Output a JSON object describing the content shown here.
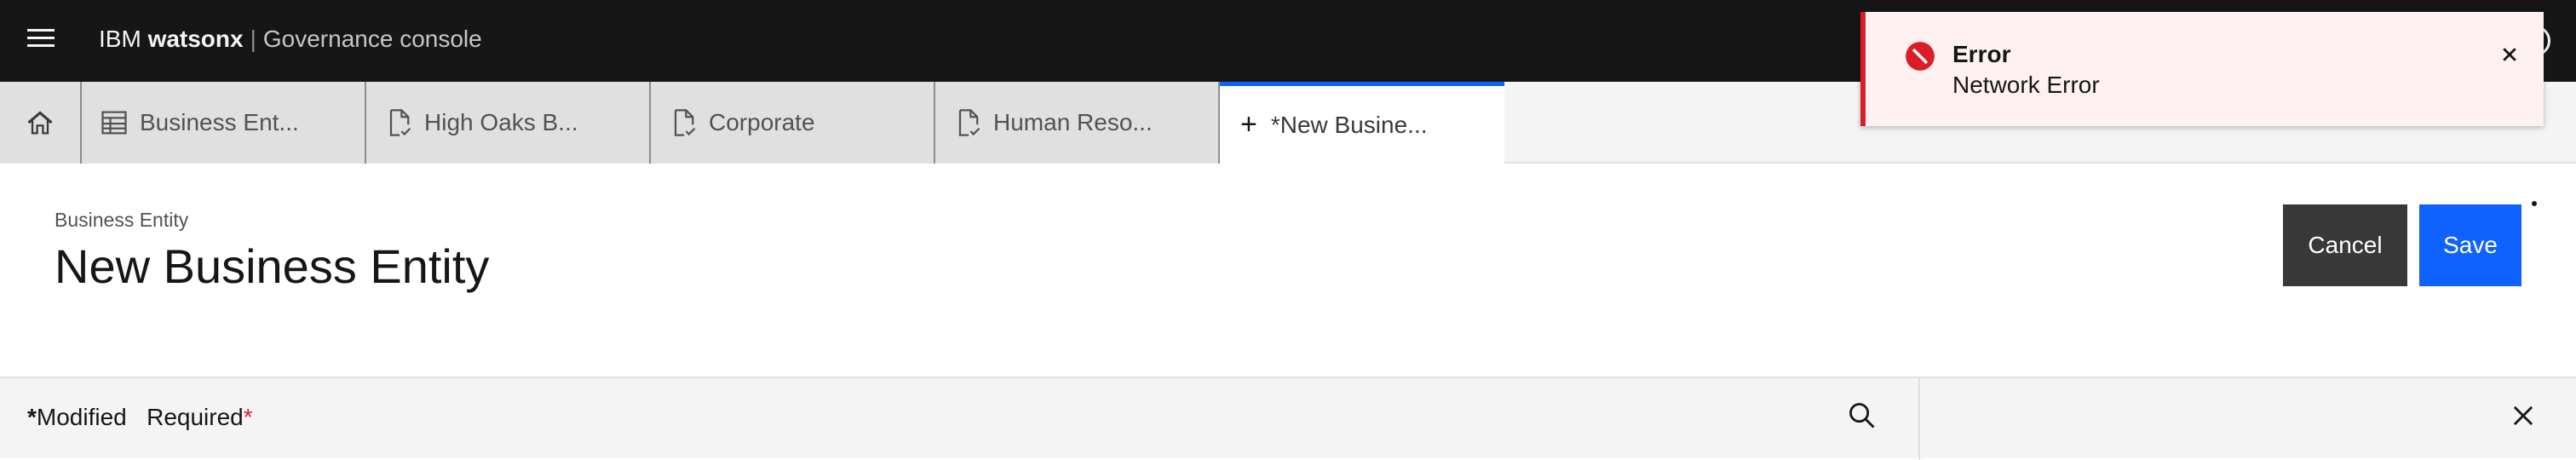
{
  "header": {
    "brand_prefix": "IBM ",
    "brand_bold": "watsonx",
    "separator": "|",
    "console_name": "Governance console",
    "menu_icon": "hamburger-menu-icon",
    "help_icon": "help-icon"
  },
  "tabs": [
    {
      "label": "",
      "icon": "home-icon"
    },
    {
      "label": "Business Ent...",
      "icon": "table-icon"
    },
    {
      "label": "High Oaks B...",
      "icon": "document-check-icon"
    },
    {
      "label": "Corporate",
      "icon": "document-check-icon"
    },
    {
      "label": "Human Reso...",
      "icon": "document-check-icon"
    },
    {
      "label": "*New Busine...",
      "icon": "plus-icon",
      "active": true
    }
  ],
  "page": {
    "breadcrumb": "Business Entity",
    "title": "New Business Entity",
    "cancel_label": "Cancel",
    "save_label": "Save"
  },
  "bottom": {
    "modified_star": "*",
    "modified_label": "Modified",
    "required_label": "Required",
    "required_star": "*"
  },
  "toast": {
    "title": "Error",
    "subtitle": "Network Error",
    "kind": "error"
  },
  "colors": {
    "header_bg": "#161616",
    "accent": "#0f62fe",
    "error": "#da1e28",
    "toast_bg": "#fff1f1",
    "cancel_bg": "#393939"
  }
}
